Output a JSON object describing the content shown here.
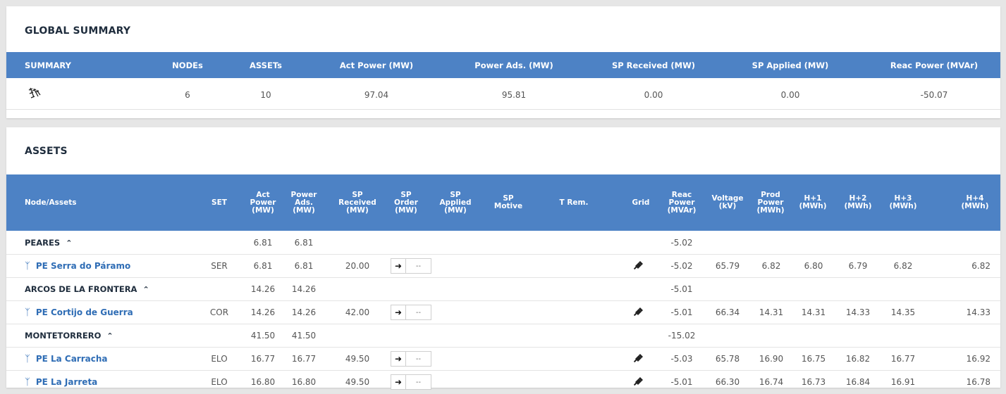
{
  "global_summary": {
    "title": "GLOBAL SUMMARY",
    "headers": {
      "summary": "SUMMARY",
      "nodes": "NODEs",
      "assets": "ASSETs",
      "act_power": "Act Power (MW)",
      "power_ads": "Power Ads. (MW)",
      "sp_received": "SP Received (MW)",
      "sp_applied": "SP Applied (MW)",
      "reac_power": "Reac Power (MVAr)"
    },
    "row": {
      "icon": "wind-farm-icon",
      "nodes": "6",
      "assets": "10",
      "act_power": "97.04",
      "power_ads": "95.81",
      "sp_received": "0.00",
      "sp_applied": "0.00",
      "reac_power": "-50.07"
    }
  },
  "assets": {
    "title": "ASSETS",
    "headers": {
      "node": "Node/Assets",
      "set": "SET",
      "act_power": "Act Power (MW)",
      "power_ads": "Power Ads. (MW)",
      "sp_received": "SP Received (MW)",
      "sp_order": "SP Order (MW)",
      "sp_applied": "SP Applied (MW)",
      "sp_motive": "SP Motive",
      "t_rem": "T Rem.",
      "grid": "Grid",
      "reac_power": "Reac Power (MVAr)",
      "voltage": "Voltage (kV)",
      "prod_power": "Prod Power (MWh)",
      "h1": "H+1 (MWh)",
      "h2": "H+2 (MWh)",
      "h3": "H+3 (MWh)",
      "h4": "H+4 (MWh)"
    },
    "rows": [
      {
        "type": "group",
        "name": "PEARES",
        "act": "6.81",
        "ads": "6.81",
        "reac": "-5.02"
      },
      {
        "type": "asset",
        "name": "PE Serra do Páramo",
        "set": "SER",
        "act": "6.81",
        "ads": "6.81",
        "spr": "20.00",
        "order_dash": "--",
        "reac": "-5.02",
        "volt": "65.79",
        "prod": "6.82",
        "h1": "6.80",
        "h2": "6.79",
        "h3": "6.82",
        "h4": "6.82"
      },
      {
        "type": "group",
        "name": "ARCOS DE LA FRONTERA",
        "act": "14.26",
        "ads": "14.26",
        "reac": "-5.01"
      },
      {
        "type": "asset",
        "name": "PE Cortijo de Guerra",
        "set": "COR",
        "act": "14.26",
        "ads": "14.26",
        "spr": "42.00",
        "order_dash": "--",
        "reac": "-5.01",
        "volt": "66.34",
        "prod": "14.31",
        "h1": "14.31",
        "h2": "14.33",
        "h3": "14.35",
        "h4": "14.33"
      },
      {
        "type": "group",
        "name": "MONTETORRERO",
        "act": "41.50",
        "ads": "41.50",
        "reac": "-15.02"
      },
      {
        "type": "asset",
        "name": "PE La Carracha",
        "set": "ELO",
        "act": "16.77",
        "ads": "16.77",
        "spr": "49.50",
        "order_dash": "--",
        "reac": "-5.03",
        "volt": "65.78",
        "prod": "16.90",
        "h1": "16.75",
        "h2": "16.82",
        "h3": "16.77",
        "h4": "16.92"
      },
      {
        "type": "asset",
        "name": "PE La Jarreta",
        "set": "ELO",
        "act": "16.80",
        "ads": "16.80",
        "spr": "49.50",
        "order_dash": "--",
        "reac": "-5.01",
        "volt": "66.30",
        "prod": "16.74",
        "h1": "16.73",
        "h2": "16.84",
        "h3": "16.91",
        "h4": "16.78"
      }
    ]
  },
  "colors": {
    "header_bg": "#4d82c5",
    "link": "#2f6db5",
    "page_bg": "#e6e6e6"
  }
}
